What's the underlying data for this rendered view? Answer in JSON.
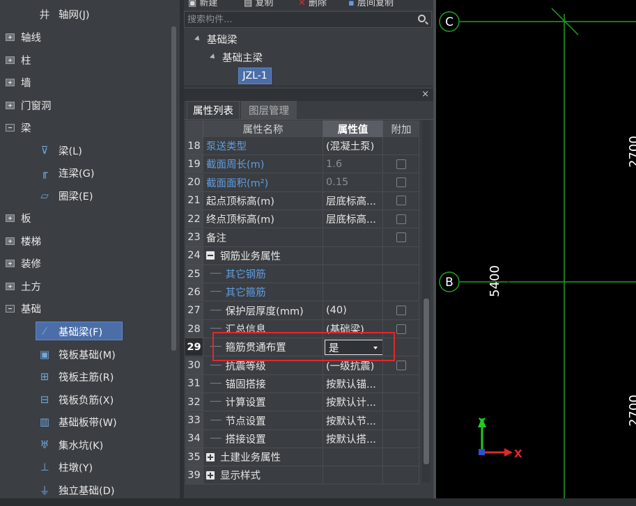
{
  "left_tree": {
    "items": [
      {
        "label": "轴网(J)",
        "kind": "leaf",
        "icon": "grid-axis-icon",
        "glyph": "井"
      },
      {
        "label": "轴线",
        "kind": "collapsed"
      },
      {
        "label": "柱",
        "kind": "collapsed"
      },
      {
        "label": "墙",
        "kind": "collapsed"
      },
      {
        "label": "门窗洞",
        "kind": "collapsed"
      },
      {
        "label": "梁",
        "kind": "expanded"
      },
      {
        "label": "梁(L)",
        "kind": "leaf",
        "icon": "beam-icon",
        "glyph": "⊽"
      },
      {
        "label": "连梁(G)",
        "kind": "leaf",
        "icon": "coupling-beam-icon",
        "glyph": "╓"
      },
      {
        "label": "圈梁(E)",
        "kind": "leaf",
        "icon": "ring-beam-icon",
        "glyph": "▱"
      },
      {
        "label": "板",
        "kind": "collapsed"
      },
      {
        "label": "楼梯",
        "kind": "collapsed"
      },
      {
        "label": "装修",
        "kind": "collapsed"
      },
      {
        "label": "土方",
        "kind": "collapsed"
      },
      {
        "label": "基础",
        "kind": "expanded"
      },
      {
        "label": "基础梁(F)",
        "kind": "leaf",
        "icon": "foundation-beam-icon",
        "glyph": "⁄",
        "selected": true
      },
      {
        "label": "筏板基础(M)",
        "kind": "leaf",
        "icon": "raft-foundation-icon",
        "glyph": "▣"
      },
      {
        "label": "筏板主筋(R)",
        "kind": "leaf",
        "icon": "raft-main-rebar-icon",
        "glyph": "⊞"
      },
      {
        "label": "筏板负筋(X)",
        "kind": "leaf",
        "icon": "raft-negative-rebar-icon",
        "glyph": "⊟"
      },
      {
        "label": "基础板带(W)",
        "kind": "leaf",
        "icon": "foundation-strip-icon",
        "glyph": "▥"
      },
      {
        "label": "集水坑(K)",
        "kind": "leaf",
        "icon": "sump-pit-icon",
        "glyph": "♅"
      },
      {
        "label": "柱墩(Y)",
        "kind": "leaf",
        "icon": "column-pier-icon",
        "glyph": "⊥"
      },
      {
        "label": "独立基础(D)",
        "kind": "leaf",
        "icon": "isolated-foundation-icon",
        "glyph": "⏚"
      }
    ]
  },
  "toolbar": {
    "new_label": "新建",
    "copy_label": "复制",
    "delete_label": "删除",
    "layer_copy_label": "层间复制"
  },
  "search": {
    "placeholder": "搜索构件..."
  },
  "component_tree": {
    "root": "基础梁",
    "child": "基础主梁",
    "selected": "JZL-1"
  },
  "tabs": {
    "props": "属性列表",
    "layers": "图层管理"
  },
  "close_glyph": "×",
  "prop_table": {
    "headers": {
      "name": "属性名称",
      "value": "属性值",
      "extra": "附加"
    },
    "rows": [
      {
        "num": "18",
        "name": "泵送类型",
        "value": "(混凝土泵)",
        "style": "blue",
        "check": false
      },
      {
        "num": "19",
        "name": "截面周长(m)",
        "value": "1.6",
        "style": "blue",
        "valstyle": "grey",
        "check": true
      },
      {
        "num": "20",
        "name": "截面面积(m²)",
        "value": "0.15",
        "style": "blue",
        "valstyle": "grey",
        "check": true
      },
      {
        "num": "21",
        "name": "起点顶标高(m)",
        "value": "层底标高...",
        "check": true
      },
      {
        "num": "22",
        "name": "终点顶标高(m)",
        "value": "层底标高...",
        "check": true
      },
      {
        "num": "23",
        "name": "备注",
        "value": "",
        "check": true
      },
      {
        "num": "24",
        "name": "钢筋业务属性",
        "value": "",
        "group": "minus"
      },
      {
        "num": "25",
        "name": "其它钢筋",
        "value": "",
        "style": "blue",
        "child": true
      },
      {
        "num": "26",
        "name": "其它箍筋",
        "value": "",
        "style": "blue",
        "child": true
      },
      {
        "num": "27",
        "name": "保护层厚度(mm)",
        "value": "(40)",
        "child": true,
        "check": true
      },
      {
        "num": "28",
        "name": "汇总信息",
        "value": "(基础梁)",
        "child": true,
        "check": true
      },
      {
        "num": "29",
        "name": "箍筋贯通布置",
        "value": "是",
        "child": true,
        "active": true
      },
      {
        "num": "30",
        "name": "抗震等级",
        "value": "(一级抗震)",
        "child": true,
        "check": true
      },
      {
        "num": "31",
        "name": "锚固搭接",
        "value": "按默认锚...",
        "child": true
      },
      {
        "num": "32",
        "name": "计算设置",
        "value": "按默认计...",
        "child": true
      },
      {
        "num": "33",
        "name": "节点设置",
        "value": "按默认节...",
        "child": true
      },
      {
        "num": "34",
        "name": "搭接设置",
        "value": "按默认搭...",
        "child": true
      },
      {
        "num": "35",
        "name": "土建业务属性",
        "value": "",
        "group": "plus"
      },
      {
        "num": "39",
        "name": "显示样式",
        "value": "",
        "group": "plus"
      }
    ]
  },
  "canvas": {
    "axis_c": "C",
    "axis_b": "B",
    "dim_5400": "5400",
    "dim_2700_top": "2700",
    "dim_2700_bottom": "2700",
    "ucs_x": "X",
    "ucs_y": "Y",
    "grid_color": "#1fa31f"
  },
  "colors": {
    "accent": "#4b6ea8",
    "link_blue": "#5f9de0",
    "highlight_red": "#e2282c",
    "canvas_bg": "#000000"
  }
}
